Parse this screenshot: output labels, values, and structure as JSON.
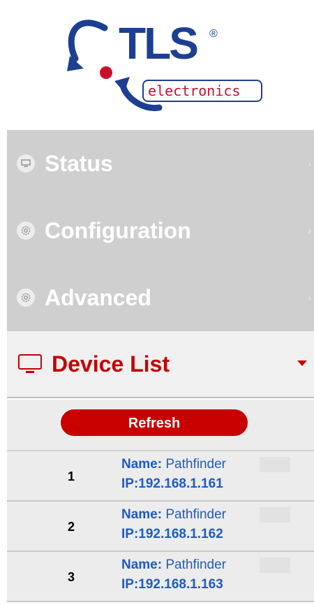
{
  "logo": {
    "brand": "TLS",
    "registered": "®",
    "sub": "electronics",
    "colors": {
      "blue": "#1d3f92",
      "red": "#c8102e"
    }
  },
  "nav": {
    "items": [
      {
        "label": "Status",
        "icon": "monitor-circle-icon"
      },
      {
        "label": "Configuration",
        "icon": "gear-circle-icon"
      },
      {
        "label": "Advanced",
        "icon": "gear-circle-icon"
      }
    ],
    "arrow": "›"
  },
  "device_list": {
    "title": "Device List",
    "refresh_label": "Refresh",
    "devices": [
      {
        "index": "1",
        "name_label": "Name:",
        "name": "Pathfinder",
        "ip": "IP:192.168.1.161"
      },
      {
        "index": "2",
        "name_label": "Name:",
        "name": "Pathfinder",
        "ip": "IP:192.168.1.162"
      },
      {
        "index": "3",
        "name_label": "Name:",
        "name": "Pathfinder",
        "ip": "IP:192.168.1.163"
      }
    ]
  },
  "colors": {
    "accent": "#c40000",
    "link": "#1f5cc2",
    "menu_bg": "#cfcfcf"
  }
}
